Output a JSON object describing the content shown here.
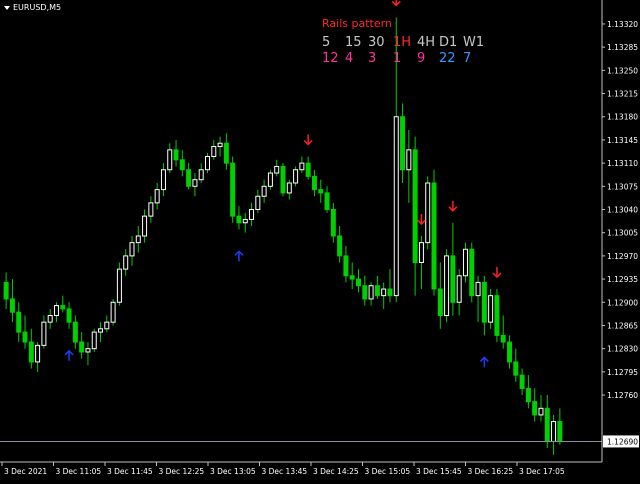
{
  "header": {
    "symbol": "EURUSD,M5"
  },
  "panel": {
    "title": "Rails pattern",
    "timeframes": [
      "5",
      "15",
      "30",
      "1H",
      "4H",
      "D1",
      "W1"
    ],
    "timeframe_colors": [
      "#c8c8c8",
      "#c8c8c8",
      "#c8c8c8",
      "#ff2a2a",
      "#c8c8c8",
      "#c8c8c8",
      "#c8c8c8"
    ],
    "counts": [
      "12",
      "4",
      "3",
      "1",
      "9",
      "22",
      "7"
    ],
    "count_colors": [
      "#ff3399",
      "#ff3399",
      "#ff3399",
      "#ff3399",
      "#ff3399",
      "#3399ff",
      "#3399ff"
    ]
  },
  "current_price": "1.12690",
  "chart_data": {
    "type": "candlestick",
    "symbol": "EURUSD",
    "timeframe": "M5",
    "price_axis_ticks": [
      "1.13320",
      "1.13285",
      "1.13250",
      "1.13215",
      "1.13180",
      "1.13145",
      "1.13110",
      "1.13075",
      "1.13040",
      "1.13005",
      "1.12970",
      "1.12935",
      "1.12900",
      "1.12865",
      "1.12830",
      "1.12795",
      "1.12760"
    ],
    "price_range": [
      1.12662,
      1.13335
    ],
    "time_axis_labels": [
      "3 Dec 2021",
      "3 Dec 11:05",
      "3 Dec 11:45",
      "3 Dec 12:25",
      "3 Dec 13:05",
      "3 Dec 13:45",
      "3 Dec 14:25",
      "3 Dec 15:05",
      "3 Dec 15:45",
      "3 Dec 16:25",
      "3 Dec 17:05"
    ],
    "bull_color": "#ffffff",
    "bear_color": "#00d000",
    "grid": false,
    "candles": [
      [
        1.1293,
        1.12945,
        1.1289,
        1.12905
      ],
      [
        1.12905,
        1.12935,
        1.1287,
        1.12885
      ],
      [
        1.12885,
        1.129,
        1.1284,
        1.12855
      ],
      [
        1.12855,
        1.1288,
        1.1283,
        1.1284
      ],
      [
        1.1284,
        1.1286,
        1.128,
        1.1281
      ],
      [
        1.1281,
        1.1284,
        1.12795,
        1.12835
      ],
      [
        1.12835,
        1.1288,
        1.1283,
        1.1287
      ],
      [
        1.1287,
        1.1289,
        1.1286,
        1.1288
      ],
      [
        1.1288,
        1.129,
        1.1287,
        1.12895
      ],
      [
        1.12895,
        1.1291,
        1.12885,
        1.1289
      ],
      [
        1.1289,
        1.129,
        1.1286,
        1.1287
      ],
      [
        1.1287,
        1.1288,
        1.1283,
        1.1284
      ],
      [
        1.1284,
        1.12855,
        1.12815,
        1.12825
      ],
      [
        1.12825,
        1.1284,
        1.12805,
        1.1283
      ],
      [
        1.1283,
        1.1286,
        1.12825,
        1.12855
      ],
      [
        1.12855,
        1.1287,
        1.1284,
        1.1286
      ],
      [
        1.1286,
        1.1288,
        1.12855,
        1.1287
      ],
      [
        1.1287,
        1.12905,
        1.12865,
        1.129
      ],
      [
        1.129,
        1.1296,
        1.12895,
        1.1295
      ],
      [
        1.1295,
        1.1298,
        1.1294,
        1.1297
      ],
      [
        1.1297,
        1.13,
        1.12955,
        1.1299
      ],
      [
        1.1299,
        1.13015,
        1.12975,
        1.13
      ],
      [
        1.13,
        1.1304,
        1.1299,
        1.1303
      ],
      [
        1.1303,
        1.1306,
        1.1302,
        1.1305
      ],
      [
        1.1305,
        1.1308,
        1.1304,
        1.1307
      ],
      [
        1.1307,
        1.1311,
        1.1306,
        1.131
      ],
      [
        1.131,
        1.1314,
        1.13095,
        1.1313
      ],
      [
        1.1313,
        1.13145,
        1.13105,
        1.13115
      ],
      [
        1.13115,
        1.1313,
        1.1309,
        1.131
      ],
      [
        1.131,
        1.1311,
        1.1307,
        1.13075
      ],
      [
        1.13075,
        1.13095,
        1.1306,
        1.13085
      ],
      [
        1.13085,
        1.1311,
        1.1308,
        1.131
      ],
      [
        1.131,
        1.13125,
        1.13095,
        1.1312
      ],
      [
        1.1312,
        1.13145,
        1.13115,
        1.13135
      ],
      [
        1.13135,
        1.1315,
        1.1312,
        1.1314
      ],
      [
        1.1314,
        1.13155,
        1.131,
        1.1311
      ],
      [
        1.1311,
        1.1312,
        1.1302,
        1.1303
      ],
      [
        1.1303,
        1.13045,
        1.1301,
        1.1302
      ],
      [
        1.1302,
        1.13035,
        1.13005,
        1.13025
      ],
      [
        1.13025,
        1.1305,
        1.13015,
        1.1304
      ],
      [
        1.1304,
        1.1307,
        1.13035,
        1.1306
      ],
      [
        1.1306,
        1.13085,
        1.1305,
        1.13075
      ],
      [
        1.13075,
        1.131,
        1.1307,
        1.13095
      ],
      [
        1.13095,
        1.13115,
        1.1309,
        1.13105
      ],
      [
        1.13105,
        1.1311,
        1.1306,
        1.13065
      ],
      [
        1.13065,
        1.13085,
        1.13055,
        1.1308
      ],
      [
        1.1308,
        1.13105,
        1.13075,
        1.131
      ],
      [
        1.131,
        1.1312,
        1.13095,
        1.1311
      ],
      [
        1.1311,
        1.1312,
        1.13085,
        1.1309
      ],
      [
        1.1309,
        1.131,
        1.1306,
        1.1307
      ],
      [
        1.1307,
        1.13085,
        1.1305,
        1.13065
      ],
      [
        1.13065,
        1.13075,
        1.13035,
        1.1304
      ],
      [
        1.1304,
        1.1305,
        1.1299,
        1.13
      ],
      [
        1.13,
        1.13015,
        1.1296,
        1.1297
      ],
      [
        1.1297,
        1.12985,
        1.1293,
        1.1294
      ],
      [
        1.1294,
        1.1296,
        1.1292,
        1.12935
      ],
      [
        1.12935,
        1.1295,
        1.12915,
        1.12925
      ],
      [
        1.12925,
        1.1294,
        1.12895,
        1.12905
      ],
      [
        1.12905,
        1.1293,
        1.12895,
        1.12925
      ],
      [
        1.12925,
        1.1294,
        1.12905,
        1.1291
      ],
      [
        1.1291,
        1.1293,
        1.1289,
        1.1292
      ],
      [
        1.1292,
        1.1295,
        1.129,
        1.1291
      ],
      [
        1.1291,
        1.1333,
        1.129,
        1.1318
      ],
      [
        1.1318,
        1.132,
        1.1308,
        1.131
      ],
      [
        1.131,
        1.1316,
        1.1305,
        1.1313
      ],
      [
        1.1313,
        1.1315,
        1.1291,
        1.1296
      ],
      [
        1.1296,
        1.13,
        1.1292,
        1.1299
      ],
      [
        1.1299,
        1.1309,
        1.1298,
        1.1308
      ],
      [
        1.1308,
        1.131,
        1.1291,
        1.1292
      ],
      [
        1.1292,
        1.1296,
        1.1286,
        1.1288
      ],
      [
        1.1288,
        1.1298,
        1.1287,
        1.1297
      ],
      [
        1.1297,
        1.1302,
        1.1288,
        1.129
      ],
      [
        1.129,
        1.1295,
        1.1288,
        1.1294
      ],
      [
        1.1294,
        1.1299,
        1.1293,
        1.1298
      ],
      [
        1.1298,
        1.1299,
        1.129,
        1.1291
      ],
      [
        1.1291,
        1.1294,
        1.1287,
        1.1293
      ],
      [
        1.1293,
        1.1294,
        1.1285,
        1.1287
      ],
      [
        1.1287,
        1.1292,
        1.1286,
        1.1291
      ],
      [
        1.1291,
        1.1292,
        1.1284,
        1.1285
      ],
      [
        1.1285,
        1.1288,
        1.1283,
        1.1284
      ],
      [
        1.1284,
        1.1285,
        1.128,
        1.1281
      ],
      [
        1.1281,
        1.1283,
        1.1278,
        1.1279
      ],
      [
        1.1279,
        1.128,
        1.1276,
        1.1277
      ],
      [
        1.1277,
        1.1279,
        1.1274,
        1.1275
      ],
      [
        1.1275,
        1.1277,
        1.1272,
        1.1273
      ],
      [
        1.1273,
        1.1276,
        1.1272,
        1.1274
      ],
      [
        1.1274,
        1.1276,
        1.1268,
        1.1269
      ],
      [
        1.1269,
        1.1273,
        1.1267,
        1.1272
      ],
      [
        1.1272,
        1.1274,
        1.12685,
        1.1269
      ]
    ],
    "arrows": [
      {
        "type": "up",
        "candle": 10
      },
      {
        "type": "up",
        "candle": 37
      },
      {
        "type": "down",
        "candle": 48
      },
      {
        "type": "down",
        "candle": 62
      },
      {
        "type": "down",
        "candle": 66
      },
      {
        "type": "down",
        "candle": 71
      },
      {
        "type": "up",
        "candle": 76
      },
      {
        "type": "down",
        "candle": 78
      }
    ],
    "arrow_colors": {
      "up": "#1f3cff",
      "down": "#ff2020"
    }
  }
}
